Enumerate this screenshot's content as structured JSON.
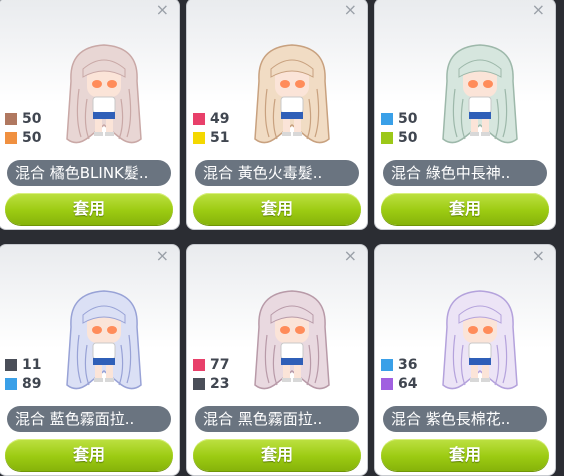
{
  "close_glyph": "×",
  "apply_label": "套用",
  "cards": [
    {
      "name": "混合 橘色BLINK髮..",
      "hair_color": "#e8d6d4",
      "hair_shade": "#c9a8a6",
      "swatches": [
        {
          "color": "#b07860",
          "value": "50"
        },
        {
          "color": "#f09040",
          "value": "50"
        }
      ]
    },
    {
      "name": "混合 黃色火毒髮..",
      "hair_color": "#f1dcc4",
      "hair_shade": "#c8a17f",
      "swatches": [
        {
          "color": "#e8406a",
          "value": "49"
        },
        {
          "color": "#f4d800",
          "value": "51"
        }
      ]
    },
    {
      "name": "混合 綠色中長神..",
      "hair_color": "#d6e6de",
      "hair_shade": "#9db8aa",
      "swatches": [
        {
          "color": "#3aa0e8",
          "value": "50"
        },
        {
          "color": "#9cc818",
          "value": "50"
        }
      ]
    },
    {
      "name": "混合 藍色霧面拉..",
      "hair_color": "#dbe0f5",
      "hair_shade": "#98a2d6",
      "swatches": [
        {
          "color": "#4a4e58",
          "value": "11"
        },
        {
          "color": "#3aa0e8",
          "value": "89"
        }
      ]
    },
    {
      "name": "混合 黑色霧面拉..",
      "hair_color": "#e9d9e0",
      "hair_shade": "#b89aa8",
      "swatches": [
        {
          "color": "#e8406a",
          "value": "77"
        },
        {
          "color": "#4a4e58",
          "value": "23"
        }
      ]
    },
    {
      "name": "混合 紫色長棉花..",
      "hair_color": "#ece4f6",
      "hair_shade": "#b4a2dc",
      "swatches": [
        {
          "color": "#3aa0e8",
          "value": "36"
        },
        {
          "color": "#a060e0",
          "value": "64"
        }
      ]
    }
  ]
}
